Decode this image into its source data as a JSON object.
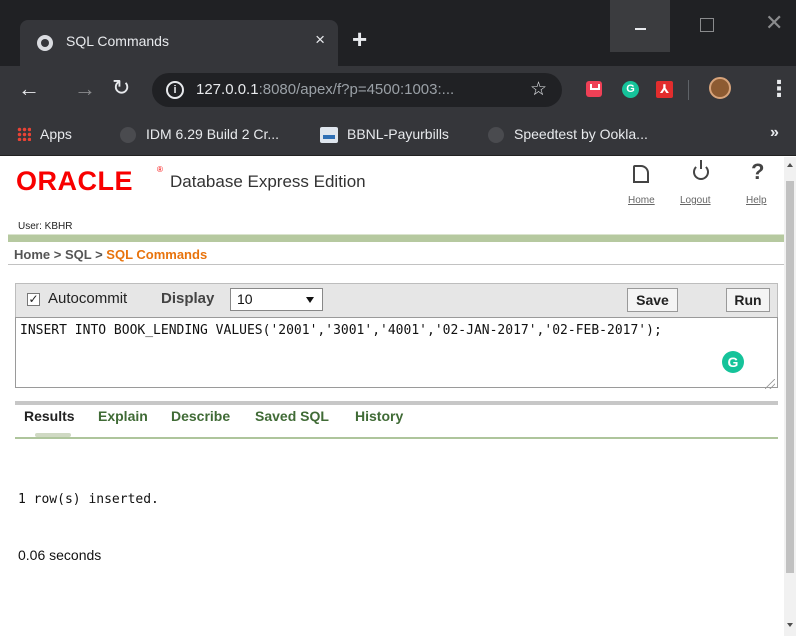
{
  "browser": {
    "tab_title": "SQL Commands",
    "tab_close": "×",
    "new_tab": "+",
    "url_host": "127.0.0.1",
    "url_rest": ":8080/apex/f?p=4500:1003:...",
    "bookmarks": [
      {
        "label": "Apps"
      },
      {
        "label": "IDM 6.29 Build 2 Cr..."
      },
      {
        "label": "BBNL-Payurbills"
      },
      {
        "label": "Speedtest by Ookla..."
      }
    ],
    "bookmarks_more": "»"
  },
  "header": {
    "logo": "ORACLE",
    "tm": "®",
    "product": "Database Express Edition",
    "home_link": "Home",
    "logout_link": "Logout",
    "help_link": "Help",
    "help_glyph": "?",
    "user_label": "User: KBHR"
  },
  "breadcrumb": {
    "home": "Home",
    "sep1": " > ",
    "sql": "SQL",
    "sep2": " > ",
    "current": "SQL Commands"
  },
  "commands": {
    "autocommit_checked": "✓",
    "autocommit_label": "Autocommit",
    "display_label": "Display",
    "display_value": "10",
    "save_label": "Save",
    "run_label": "Run",
    "sql_text": "INSERT INTO BOOK_LENDING VALUES('2001','3001','4001','02-JAN-2017','02-FEB-2017');"
  },
  "results": {
    "tabs": [
      "Results",
      "Explain",
      "Describe",
      "Saved SQL",
      "History"
    ],
    "message": "1 row(s) inserted.",
    "elapsed": "0.06 seconds"
  },
  "colors": {
    "oracle_red": "#f80000",
    "breadcrumb_current": "#e8730c",
    "tab_link_green": "#406b36",
    "grammarly": "#15c39a"
  }
}
